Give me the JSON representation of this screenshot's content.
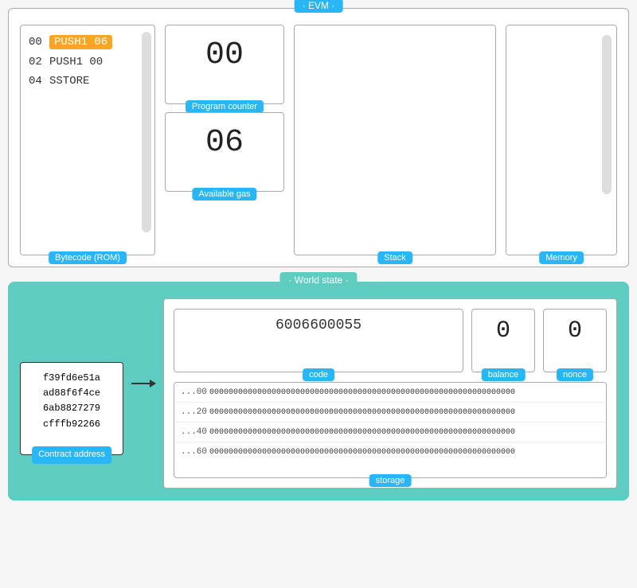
{
  "evm": {
    "title": "· EVM ·",
    "bytecode": {
      "label": "Bytecode (ROM)",
      "rows": [
        {
          "offset": "00",
          "instruction": "PUSH1 06",
          "highlighted": true
        },
        {
          "offset": "02",
          "instruction": "PUSH1 00",
          "highlighted": false
        },
        {
          "offset": "04",
          "instruction": "SSTORE",
          "highlighted": false
        }
      ]
    },
    "programCounter": {
      "value": "00",
      "label": "Program counter"
    },
    "availableGas": {
      "value": "06",
      "label": "Available gas"
    },
    "stack": {
      "label": "Stack"
    },
    "memory": {
      "label": "Memory"
    }
  },
  "worldState": {
    "title": "· World state ·",
    "contractAddress": {
      "lines": [
        "f39fd6e51a",
        "ad88f6f4ce",
        "6ab8827279",
        "cfffb92266"
      ],
      "label": "Contract address"
    },
    "account": {
      "code": {
        "value": "6006600055",
        "label": "code"
      },
      "balance": {
        "value": "0",
        "label": "balance"
      },
      "nonce": {
        "value": "0",
        "label": "nonce"
      },
      "storage": {
        "label": "storage",
        "rows": [
          {
            "offset": "...00",
            "value": "0000000000000000000000000000000000000000000000000000000000000000"
          },
          {
            "offset": "...20",
            "value": "0000000000000000000000000000000000000000000000000000000000000000"
          },
          {
            "offset": "...40",
            "value": "0000000000000000000000000000000000000000000000000000000000000000"
          },
          {
            "offset": "...60",
            "value": "0000000000000000000000000000000000000000000000000000000000000000"
          }
        ]
      }
    }
  }
}
